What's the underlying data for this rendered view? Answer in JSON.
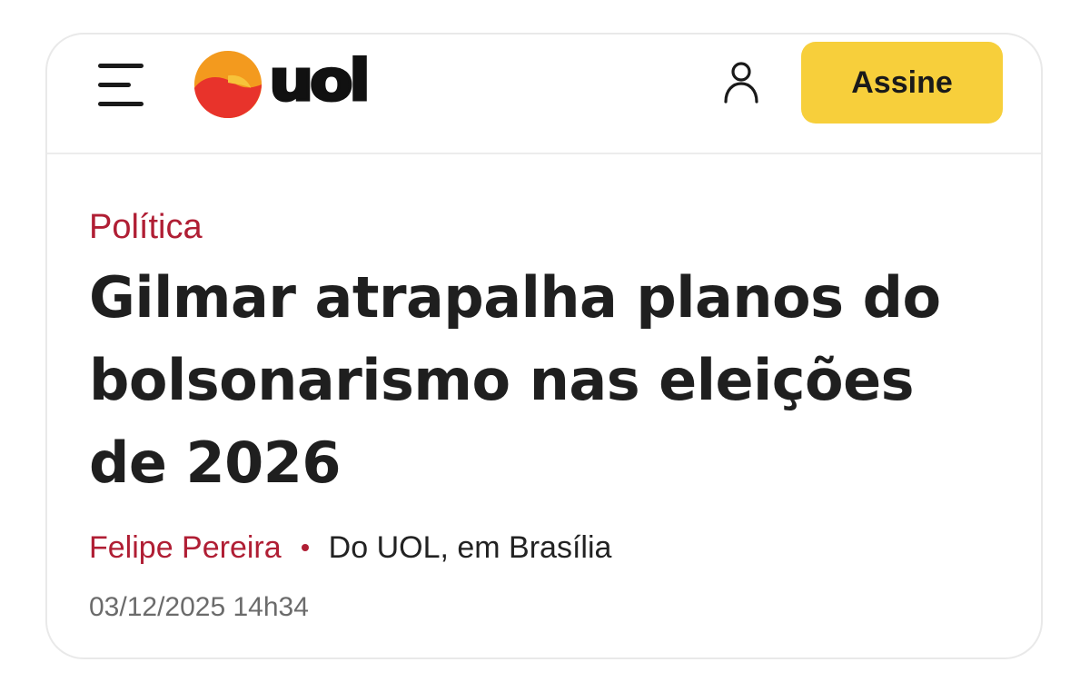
{
  "header": {
    "logo_text": "uol",
    "subscribe_label": "Assine",
    "icons": [
      "menu-icon",
      "uol-sun-icon",
      "user-icon"
    ]
  },
  "article": {
    "category": "Política",
    "headline": "Gilmar atrapalha planos do bolsonarismo nas eleições de 2026",
    "author": "Felipe Pereira",
    "origin": "Do UOL, em Brasília",
    "timestamp": "03/12/2025 14h34"
  },
  "colors": {
    "accent": "#b01e34",
    "subscribe_bg": "#f7cf3b",
    "logo_orange": "#f39a1e",
    "logo_red": "#e8332b"
  }
}
